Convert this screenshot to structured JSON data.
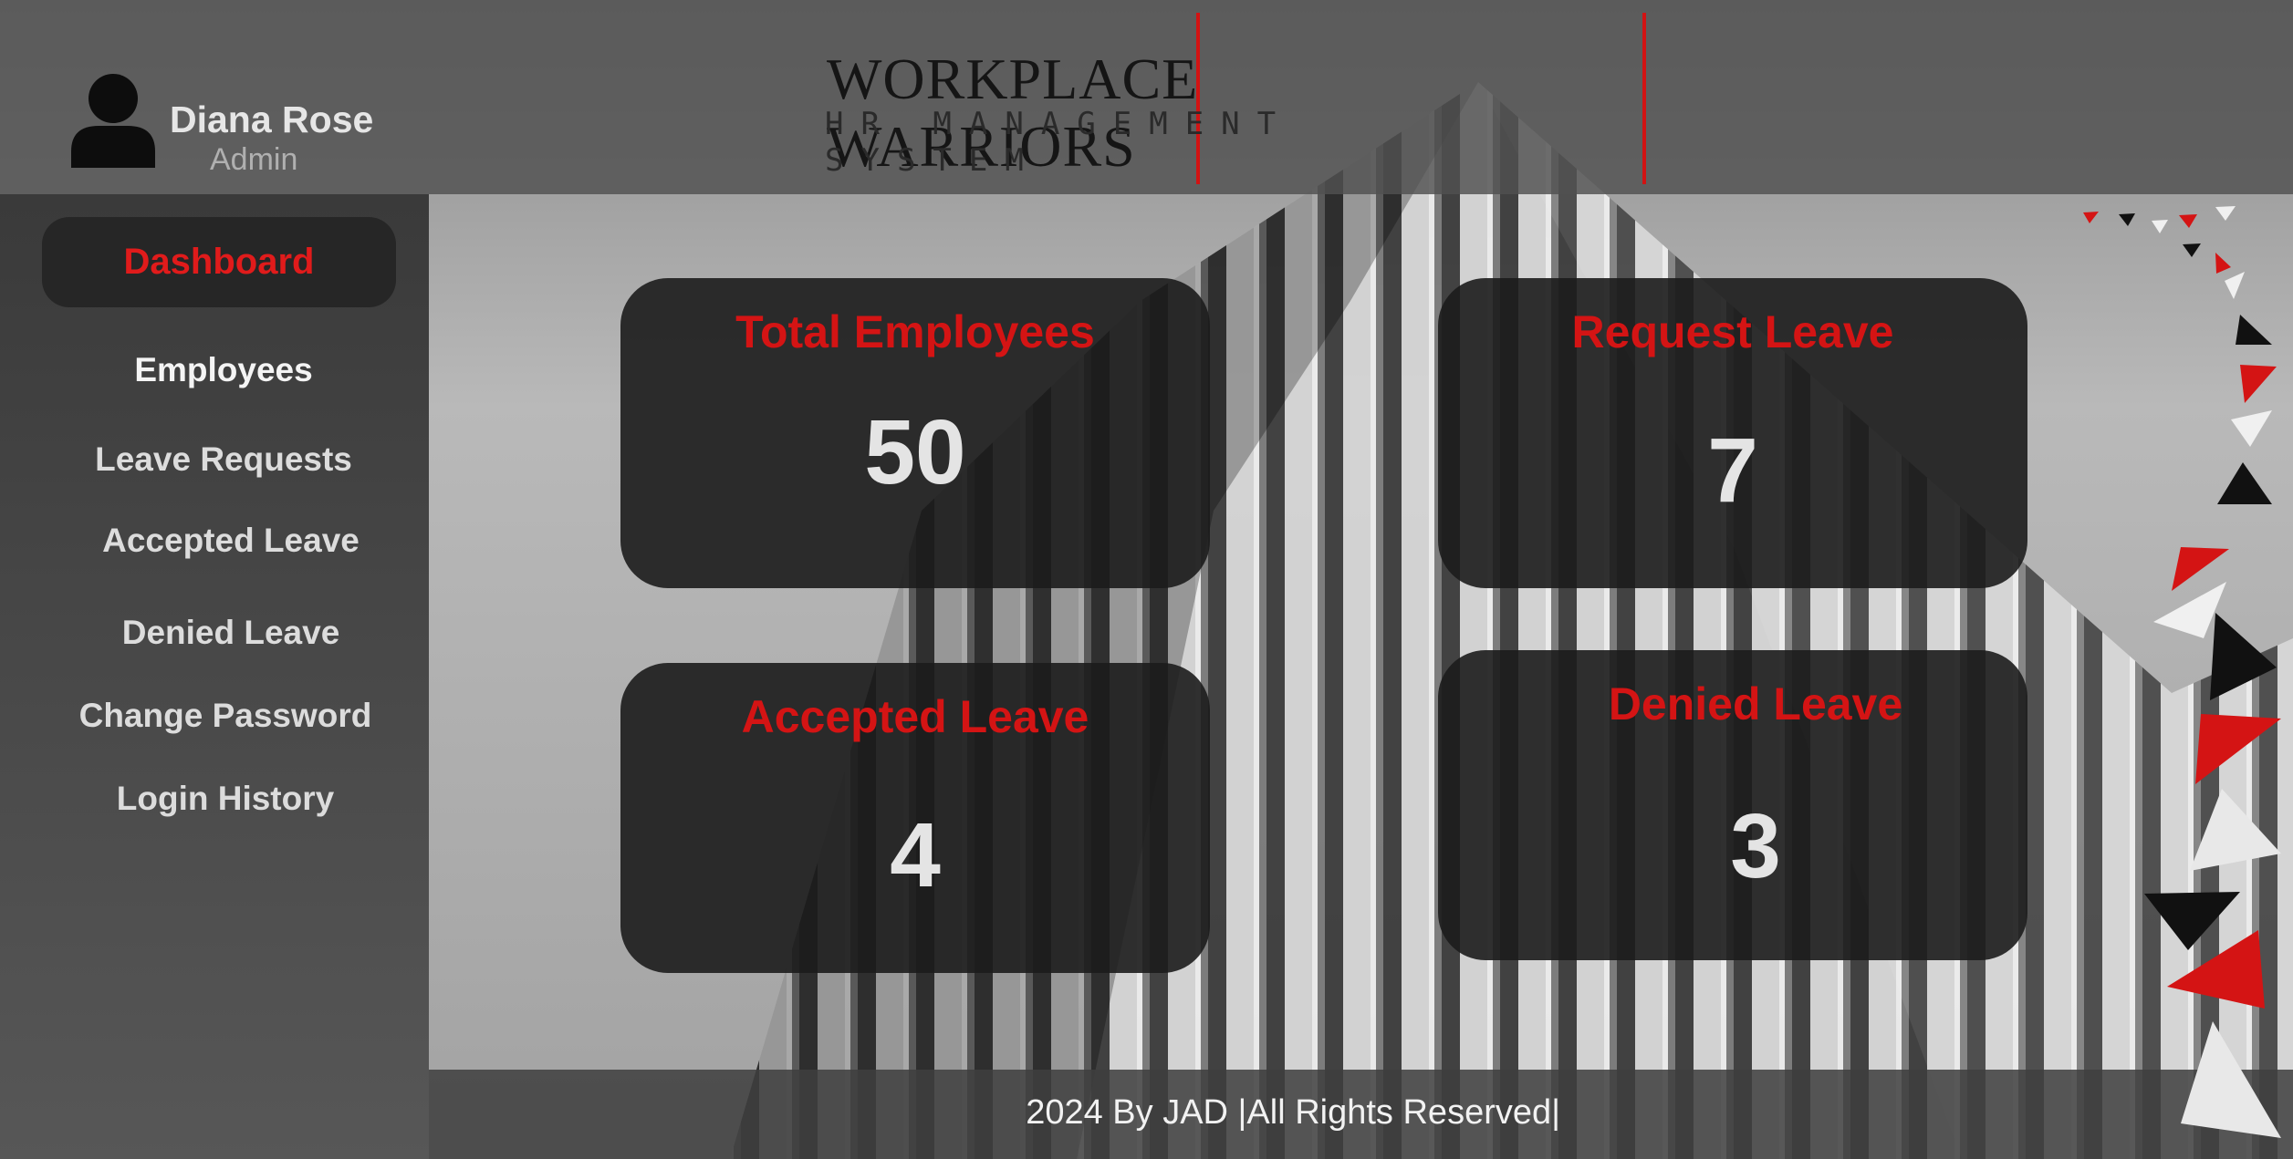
{
  "brand": {
    "title": "WORKPLACE WARRIORS",
    "subtitle": "HR MANAGEMENT SYSTEM"
  },
  "user": {
    "name": "Diana Rose",
    "role": "Admin",
    "avatar_icon": "person-icon"
  },
  "sidebar": {
    "active": "Dashboard",
    "items": [
      {
        "label": "Employees"
      },
      {
        "label": "Leave Requests"
      },
      {
        "label": "Accepted Leave"
      },
      {
        "label": "Denied Leave"
      },
      {
        "label": "Change Password"
      },
      {
        "label": "Login History"
      }
    ]
  },
  "cards": [
    {
      "title": "Total Employees",
      "value": "50"
    },
    {
      "title": "Request Leave",
      "value": "7"
    },
    {
      "title": "Accepted Leave",
      "value": "4"
    },
    {
      "title": "Denied Leave",
      "value": "3"
    }
  ],
  "footer": {
    "text": "2024 By JAD |All Rights Reserved|"
  },
  "colors": {
    "accent": "#d41414",
    "card_bg": "#1c1c1c",
    "sidebar_bg": "#3f3f3f"
  }
}
